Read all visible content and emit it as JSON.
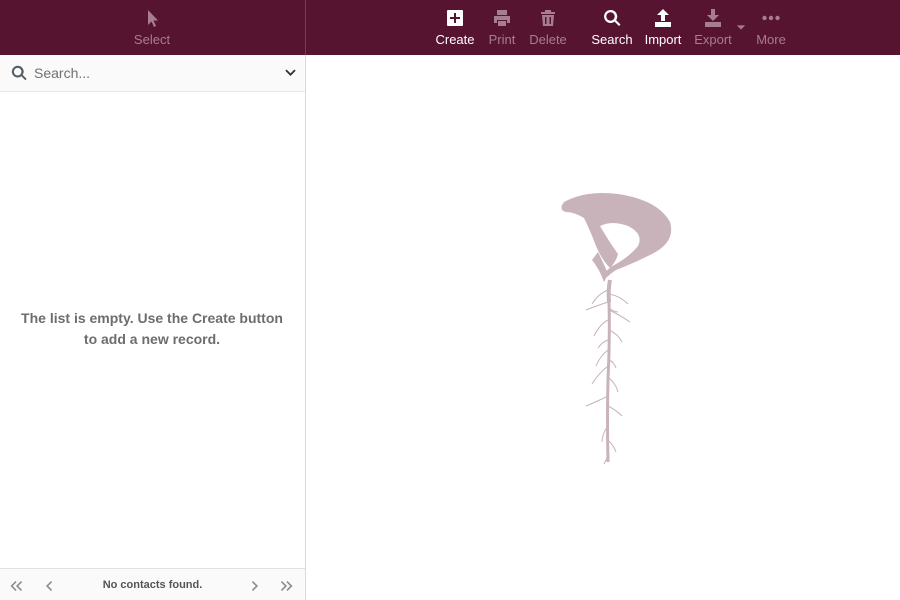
{
  "toolbar": {
    "select": {
      "label": "Select",
      "icon": "cursor-icon",
      "enabled": false
    },
    "create": {
      "label": "Create",
      "icon": "plus-square-icon",
      "enabled": true
    },
    "print": {
      "label": "Print",
      "icon": "print-icon",
      "enabled": false
    },
    "delete": {
      "label": "Delete",
      "icon": "trash-icon",
      "enabled": false
    },
    "search": {
      "label": "Search",
      "icon": "search-icon",
      "enabled": true
    },
    "import": {
      "label": "Import",
      "icon": "upload-icon",
      "enabled": true
    },
    "export": {
      "label": "Export",
      "icon": "download-icon",
      "enabled": false
    },
    "more": {
      "label": "More",
      "icon": "ellipsis-icon",
      "enabled": false
    }
  },
  "search": {
    "placeholder": "Search...",
    "value": ""
  },
  "list": {
    "empty_message": "The list is empty. Use the Create button to add a new record."
  },
  "pager": {
    "status": "No contacts found."
  },
  "colors": {
    "brand": "#571431",
    "disabled": "#a77d90",
    "logo": "#c9b3ba"
  }
}
